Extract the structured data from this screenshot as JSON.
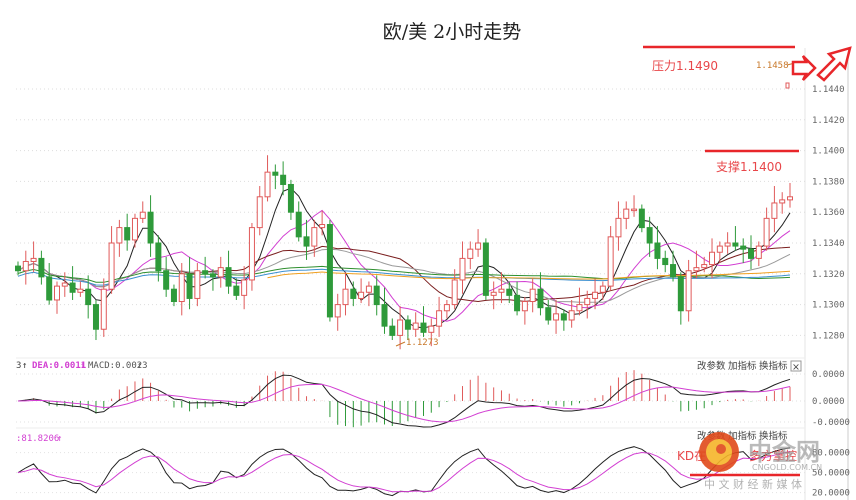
{
  "chart_data": {
    "type": "candlestick",
    "title": "欧/美 2小时走势",
    "ylim": [
      1.1262,
      1.1465
    ],
    "y_ticks": [
      "1.1440",
      "1.1420",
      "1.1400",
      "1.1380",
      "1.1360",
      "1.1340",
      "1.1320",
      "1.1300",
      "1.1280"
    ],
    "y_tick_values": [
      1.144,
      1.142,
      1.14,
      1.138,
      1.136,
      1.134,
      1.132,
      1.13,
      1.128
    ],
    "closes": [
      1.1322,
      1.1328,
      1.133,
      1.1318,
      1.1303,
      1.1312,
      1.1314,
      1.1308,
      1.131,
      1.13,
      1.1284,
      1.131,
      1.134,
      1.135,
      1.1342,
      1.1356,
      1.136,
      1.134,
      1.1322,
      1.131,
      1.1302,
      1.132,
      1.1304,
      1.1322,
      1.132,
      1.1318,
      1.1324,
      1.1312,
      1.1306,
      1.1316,
      1.135,
      1.137,
      1.1386,
      1.1384,
      1.1378,
      1.136,
      1.1344,
      1.1338,
      1.135,
      1.1352,
      1.1292,
      1.13,
      1.131,
      1.1304,
      1.1308,
      1.1312,
      1.13,
      1.1286,
      1.128,
      1.129,
      1.1284,
      1.1288,
      1.1282,
      1.1286,
      1.1296,
      1.13,
      1.1316,
      1.133,
      1.1336,
      1.134,
      1.1306,
      1.1308,
      1.131,
      1.1306,
      1.1296,
      1.1302,
      1.131,
      1.1298,
      1.129,
      1.1294,
      1.129,
      1.1296,
      1.13,
      1.1304,
      1.1308,
      1.1312,
      1.1344,
      1.1356,
      1.1362,
      1.1362,
      1.135,
      1.134,
      1.133,
      1.1326,
      1.1318,
      1.1296,
      1.1322,
      1.1324,
      1.1326,
      1.1334,
      1.1338,
      1.134,
      1.1338,
      1.1336,
      1.133,
      1.1338,
      1.1356,
      1.1366,
      1.1368,
      1.137
    ],
    "ma_periods": [
      5,
      10,
      20,
      30,
      60,
      90,
      120
    ],
    "high_label": "1.1458",
    "low_label": "1.1273",
    "annotations": {
      "resistance": "压力1.1490",
      "resistance_value": 1.149,
      "support": "支撑1.1400",
      "support_value": 1.14,
      "kd_text_a": "KD在",
      "kd_text_b": "多方掌控"
    },
    "macd": {
      "dif_label": "3",
      "dea_label": "DEA:0.0011",
      "macd_label": "MACD:0.0023",
      "y_ticks": [
        "0.0000",
        "0.0000",
        "-0.0000"
      ]
    },
    "kd": {
      "label": ":81.8206",
      "y_ticks": [
        "80.0000",
        "50.0000",
        "20.0000"
      ]
    }
  },
  "toolbar": {
    "edit_params": "改参数",
    "add_indicator": "加指标",
    "switch_indicator": "换指标",
    "close": "×"
  },
  "watermark": {
    "name": "中金网",
    "domain": "CNGOLD.COM.CN",
    "slogan": "中 文 财 经 新 媒 体"
  },
  "colors": {
    "up": "#e05a5a",
    "down": "#2e9a3a",
    "ma": [
      "#222222",
      "#d23fd2",
      "#7a1e1e",
      "#9a9a9a",
      "#2f8f2f",
      "#3a8fd0",
      "#f0a020"
    ],
    "annotation": "#e8262a"
  }
}
